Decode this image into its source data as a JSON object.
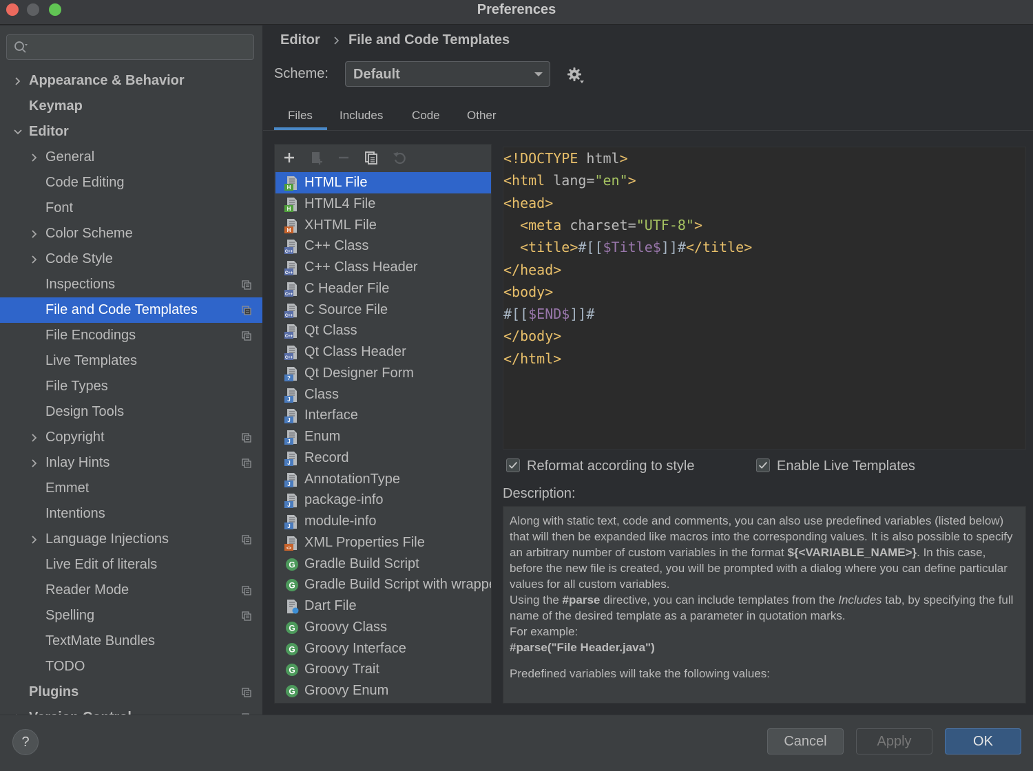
{
  "window": {
    "title": "Preferences"
  },
  "search": {
    "placeholder": ""
  },
  "sidebar": {
    "items": [
      {
        "label": "Appearance & Behavior",
        "level": 0,
        "expandable": true,
        "expanded": false,
        "bold": true
      },
      {
        "label": "Keymap",
        "level": 0,
        "expandable": false,
        "bold": true
      },
      {
        "label": "Editor",
        "level": 0,
        "expandable": true,
        "expanded": true,
        "bold": true
      },
      {
        "label": "General",
        "level": 1,
        "expandable": true,
        "expanded": false
      },
      {
        "label": "Code Editing",
        "level": 1
      },
      {
        "label": "Font",
        "level": 1
      },
      {
        "label": "Color Scheme",
        "level": 1,
        "expandable": true,
        "expanded": false
      },
      {
        "label": "Code Style",
        "level": 1,
        "expandable": true,
        "expanded": false
      },
      {
        "label": "Inspections",
        "level": 1,
        "project": true
      },
      {
        "label": "File and Code Templates",
        "level": 1,
        "project": true,
        "selected": true
      },
      {
        "label": "File Encodings",
        "level": 1,
        "project": true
      },
      {
        "label": "Live Templates",
        "level": 1
      },
      {
        "label": "File Types",
        "level": 1
      },
      {
        "label": "Design Tools",
        "level": 1
      },
      {
        "label": "Copyright",
        "level": 1,
        "expandable": true,
        "expanded": false,
        "project": true
      },
      {
        "label": "Inlay Hints",
        "level": 1,
        "expandable": true,
        "expanded": false,
        "project": true
      },
      {
        "label": "Emmet",
        "level": 1
      },
      {
        "label": "Intentions",
        "level": 1
      },
      {
        "label": "Language Injections",
        "level": 1,
        "expandable": true,
        "expanded": false,
        "project": true
      },
      {
        "label": "Live Edit of literals",
        "level": 1
      },
      {
        "label": "Reader Mode",
        "level": 1,
        "project": true
      },
      {
        "label": "Spelling",
        "level": 1,
        "project": true
      },
      {
        "label": "TextMate Bundles",
        "level": 1
      },
      {
        "label": "TODO",
        "level": 1
      },
      {
        "label": "Plugins",
        "level": 0,
        "bold": true,
        "project": true
      },
      {
        "label": "Version Control",
        "level": 0,
        "expandable": true,
        "expanded": false,
        "bold": true,
        "project": true
      }
    ]
  },
  "breadcrumb": {
    "parent": "Editor",
    "current": "File and Code Templates"
  },
  "scheme": {
    "label": "Scheme:",
    "value": "Default"
  },
  "tabs": [
    {
      "label": "Files",
      "active": true
    },
    {
      "label": "Includes"
    },
    {
      "label": "Code"
    },
    {
      "label": "Other"
    }
  ],
  "templates": [
    {
      "label": "HTML File",
      "icon": "html",
      "selected": true
    },
    {
      "label": "HTML4 File",
      "icon": "html"
    },
    {
      "label": "XHTML File",
      "icon": "xhtml"
    },
    {
      "label": "C++ Class",
      "icon": "cpp"
    },
    {
      "label": "C++ Class Header",
      "icon": "cpp"
    },
    {
      "label": "C Header File",
      "icon": "cpp"
    },
    {
      "label": "C Source File",
      "icon": "cpp"
    },
    {
      "label": "Qt Class",
      "icon": "cpp"
    },
    {
      "label": "Qt Class Header",
      "icon": "cpp"
    },
    {
      "label": "Qt Designer Form",
      "icon": "qt-form"
    },
    {
      "label": "Class",
      "icon": "java"
    },
    {
      "label": "Interface",
      "icon": "java"
    },
    {
      "label": "Enum",
      "icon": "java"
    },
    {
      "label": "Record",
      "icon": "java"
    },
    {
      "label": "AnnotationType",
      "icon": "java"
    },
    {
      "label": "package-info",
      "icon": "java"
    },
    {
      "label": "module-info",
      "icon": "java"
    },
    {
      "label": "XML Properties File",
      "icon": "xml"
    },
    {
      "label": "Gradle Build Script",
      "icon": "groovy"
    },
    {
      "label": "Gradle Build Script with wrapper",
      "icon": "groovy"
    },
    {
      "label": "Dart File",
      "icon": "dart"
    },
    {
      "label": "Groovy Class",
      "icon": "groovy"
    },
    {
      "label": "Groovy Interface",
      "icon": "groovy"
    },
    {
      "label": "Groovy Trait",
      "icon": "groovy"
    },
    {
      "label": "Groovy Enum",
      "icon": "groovy"
    }
  ],
  "editor": {
    "lines": [
      [
        {
          "t": "<!DOCTYPE",
          "c": "tag"
        },
        {
          "t": " html",
          "c": "attr"
        },
        {
          "t": ">",
          "c": "tag"
        }
      ],
      [
        {
          "t": "<html",
          "c": "tag"
        },
        {
          "t": " lang=",
          "c": "attr"
        },
        {
          "t": "\"en\"",
          "c": "str"
        },
        {
          "t": ">",
          "c": "tag"
        }
      ],
      [
        {
          "t": "<head>",
          "c": "tag"
        }
      ],
      [
        {
          "t": "  ",
          "c": "txt"
        },
        {
          "t": "<meta",
          "c": "tag"
        },
        {
          "t": " charset=",
          "c": "attr"
        },
        {
          "t": "\"UTF-8\"",
          "c": "str"
        },
        {
          "t": ">",
          "c": "tag"
        }
      ],
      [
        {
          "t": "  ",
          "c": "txt"
        },
        {
          "t": "<title>",
          "c": "tag"
        },
        {
          "t": "#[[",
          "c": "txt"
        },
        {
          "t": "$Title$",
          "c": "var"
        },
        {
          "t": "]]#",
          "c": "txt"
        },
        {
          "t": "</title>",
          "c": "tag"
        }
      ],
      [
        {
          "t": "</head>",
          "c": "tag"
        }
      ],
      [
        {
          "t": "<body>",
          "c": "tag"
        }
      ],
      [
        {
          "t": "#[[",
          "c": "txt"
        },
        {
          "t": "$END$",
          "c": "var"
        },
        {
          "t": "]]#",
          "c": "txt"
        }
      ],
      [
        {
          "t": "</body>",
          "c": "tag"
        }
      ],
      [
        {
          "t": "</html>",
          "c": "tag"
        }
      ]
    ]
  },
  "options": {
    "reformat": {
      "label": "Reformat according to style",
      "checked": true
    },
    "live_templates": {
      "label": "Enable Live Templates",
      "checked": true
    }
  },
  "description": {
    "label": "Description:",
    "p1_a": "Along with static text, code and comments, you can also use predefined variables (listed below) that will then be expanded like macros into the corresponding values. It is also possible to specify an arbitrary number of custom variables in the format ",
    "p1_b": "${<VARIABLE_NAME>}",
    "p1_c": ". In this case, before the new file is created, you will be prompted with a dialog where you can define particular values for all custom variables.",
    "p2_a": "Using the ",
    "p2_b": "#parse",
    "p2_c": " directive, you can include templates from the ",
    "p2_d": "Includes",
    "p2_e": " tab, by specifying the full name of the desired template as a parameter in quotation marks.",
    "p3": "For example:",
    "p4": "#parse(\"File Header.java\")",
    "p5": "Predefined variables will take the following values:"
  },
  "footer": {
    "help": "?",
    "cancel": "Cancel",
    "apply": "Apply",
    "ok": "OK"
  },
  "colors": {
    "selection": "#2f65ca",
    "tag": "#e8bf6a",
    "string": "#a5c261",
    "variable": "#9876aa",
    "ok_button": "#365880"
  }
}
